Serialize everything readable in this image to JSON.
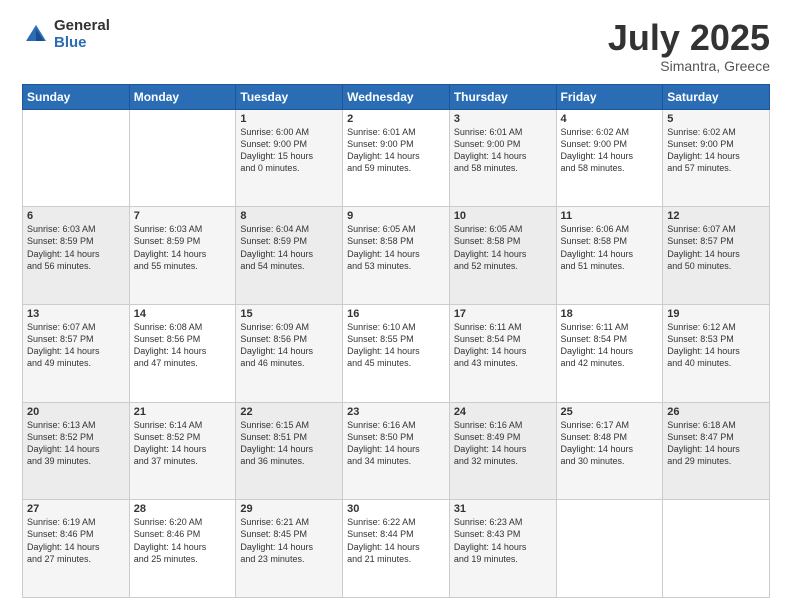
{
  "header": {
    "logo_general": "General",
    "logo_blue": "Blue",
    "title": "July 2025",
    "location": "Simantra, Greece"
  },
  "weekdays": [
    "Sunday",
    "Monday",
    "Tuesday",
    "Wednesday",
    "Thursday",
    "Friday",
    "Saturday"
  ],
  "weeks": [
    [
      {
        "day": "",
        "info": ""
      },
      {
        "day": "",
        "info": ""
      },
      {
        "day": "1",
        "info": "Sunrise: 6:00 AM\nSunset: 9:00 PM\nDaylight: 15 hours\nand 0 minutes."
      },
      {
        "day": "2",
        "info": "Sunrise: 6:01 AM\nSunset: 9:00 PM\nDaylight: 14 hours\nand 59 minutes."
      },
      {
        "day": "3",
        "info": "Sunrise: 6:01 AM\nSunset: 9:00 PM\nDaylight: 14 hours\nand 58 minutes."
      },
      {
        "day": "4",
        "info": "Sunrise: 6:02 AM\nSunset: 9:00 PM\nDaylight: 14 hours\nand 58 minutes."
      },
      {
        "day": "5",
        "info": "Sunrise: 6:02 AM\nSunset: 9:00 PM\nDaylight: 14 hours\nand 57 minutes."
      }
    ],
    [
      {
        "day": "6",
        "info": "Sunrise: 6:03 AM\nSunset: 8:59 PM\nDaylight: 14 hours\nand 56 minutes."
      },
      {
        "day": "7",
        "info": "Sunrise: 6:03 AM\nSunset: 8:59 PM\nDaylight: 14 hours\nand 55 minutes."
      },
      {
        "day": "8",
        "info": "Sunrise: 6:04 AM\nSunset: 8:59 PM\nDaylight: 14 hours\nand 54 minutes."
      },
      {
        "day": "9",
        "info": "Sunrise: 6:05 AM\nSunset: 8:58 PM\nDaylight: 14 hours\nand 53 minutes."
      },
      {
        "day": "10",
        "info": "Sunrise: 6:05 AM\nSunset: 8:58 PM\nDaylight: 14 hours\nand 52 minutes."
      },
      {
        "day": "11",
        "info": "Sunrise: 6:06 AM\nSunset: 8:58 PM\nDaylight: 14 hours\nand 51 minutes."
      },
      {
        "day": "12",
        "info": "Sunrise: 6:07 AM\nSunset: 8:57 PM\nDaylight: 14 hours\nand 50 minutes."
      }
    ],
    [
      {
        "day": "13",
        "info": "Sunrise: 6:07 AM\nSunset: 8:57 PM\nDaylight: 14 hours\nand 49 minutes."
      },
      {
        "day": "14",
        "info": "Sunrise: 6:08 AM\nSunset: 8:56 PM\nDaylight: 14 hours\nand 47 minutes."
      },
      {
        "day": "15",
        "info": "Sunrise: 6:09 AM\nSunset: 8:56 PM\nDaylight: 14 hours\nand 46 minutes."
      },
      {
        "day": "16",
        "info": "Sunrise: 6:10 AM\nSunset: 8:55 PM\nDaylight: 14 hours\nand 45 minutes."
      },
      {
        "day": "17",
        "info": "Sunrise: 6:11 AM\nSunset: 8:54 PM\nDaylight: 14 hours\nand 43 minutes."
      },
      {
        "day": "18",
        "info": "Sunrise: 6:11 AM\nSunset: 8:54 PM\nDaylight: 14 hours\nand 42 minutes."
      },
      {
        "day": "19",
        "info": "Sunrise: 6:12 AM\nSunset: 8:53 PM\nDaylight: 14 hours\nand 40 minutes."
      }
    ],
    [
      {
        "day": "20",
        "info": "Sunrise: 6:13 AM\nSunset: 8:52 PM\nDaylight: 14 hours\nand 39 minutes."
      },
      {
        "day": "21",
        "info": "Sunrise: 6:14 AM\nSunset: 8:52 PM\nDaylight: 14 hours\nand 37 minutes."
      },
      {
        "day": "22",
        "info": "Sunrise: 6:15 AM\nSunset: 8:51 PM\nDaylight: 14 hours\nand 36 minutes."
      },
      {
        "day": "23",
        "info": "Sunrise: 6:16 AM\nSunset: 8:50 PM\nDaylight: 14 hours\nand 34 minutes."
      },
      {
        "day": "24",
        "info": "Sunrise: 6:16 AM\nSunset: 8:49 PM\nDaylight: 14 hours\nand 32 minutes."
      },
      {
        "day": "25",
        "info": "Sunrise: 6:17 AM\nSunset: 8:48 PM\nDaylight: 14 hours\nand 30 minutes."
      },
      {
        "day": "26",
        "info": "Sunrise: 6:18 AM\nSunset: 8:47 PM\nDaylight: 14 hours\nand 29 minutes."
      }
    ],
    [
      {
        "day": "27",
        "info": "Sunrise: 6:19 AM\nSunset: 8:46 PM\nDaylight: 14 hours\nand 27 minutes."
      },
      {
        "day": "28",
        "info": "Sunrise: 6:20 AM\nSunset: 8:46 PM\nDaylight: 14 hours\nand 25 minutes."
      },
      {
        "day": "29",
        "info": "Sunrise: 6:21 AM\nSunset: 8:45 PM\nDaylight: 14 hours\nand 23 minutes."
      },
      {
        "day": "30",
        "info": "Sunrise: 6:22 AM\nSunset: 8:44 PM\nDaylight: 14 hours\nand 21 minutes."
      },
      {
        "day": "31",
        "info": "Sunrise: 6:23 AM\nSunset: 8:43 PM\nDaylight: 14 hours\nand 19 minutes."
      },
      {
        "day": "",
        "info": ""
      },
      {
        "day": "",
        "info": ""
      }
    ]
  ]
}
